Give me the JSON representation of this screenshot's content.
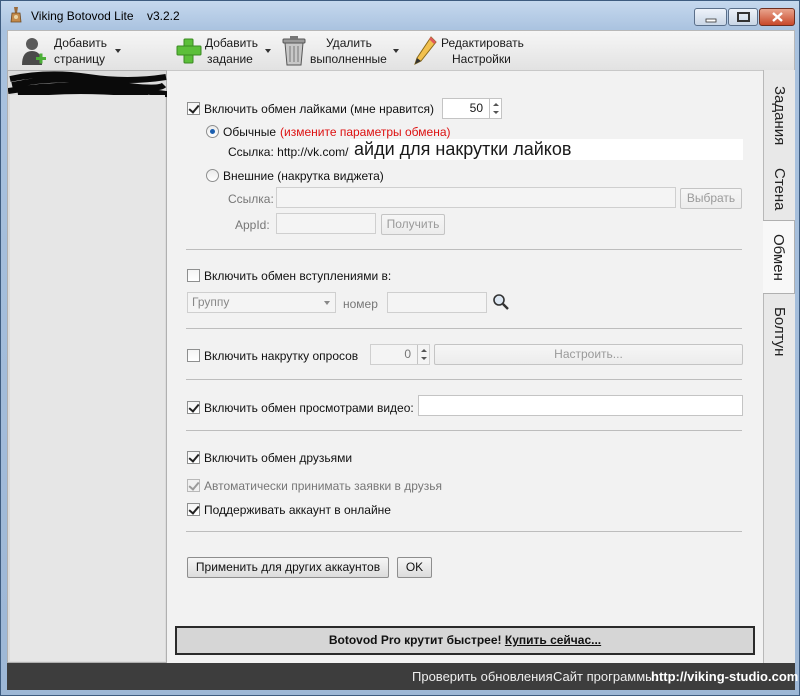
{
  "window": {
    "title": "Viking Botovod Lite",
    "version": "v3.2.2"
  },
  "toolbar": {
    "add_page": [
      "Добавить",
      "страницу"
    ],
    "add_task": [
      "Добавить",
      "задание"
    ],
    "delete_done": [
      "Удалить",
      "выполненные"
    ],
    "edit_settings": [
      "Редактировать",
      "Настройки"
    ]
  },
  "tabs": [
    "Задания",
    "Стена",
    "Обмен",
    "Болтун"
  ],
  "active_tab": "Обмен",
  "likes": {
    "checkbox_label": "Включить обмен лайками (мне нравится)",
    "checked": true,
    "count": "50",
    "normal_label": "Обычные",
    "normal_hint": "(измените параметры обмена)",
    "link_label": "Ссылка: http://vk.com/",
    "link_value": "айди для накрутки лайков",
    "external_label": "Внешние (накрутка виджета)",
    "ext_link_label": "Ссылка:",
    "choose_button": "Выбрать",
    "appid_label": "AppId:",
    "get_button": "Получить"
  },
  "joins": {
    "checkbox_label": "Включить обмен вступлениями в:",
    "checked": false,
    "select_value": "Группу",
    "number_label": "номер"
  },
  "polls": {
    "checkbox_label": "Включить накрутку опросов",
    "checked": false,
    "count": "0",
    "configure_button": "Настроить..."
  },
  "video": {
    "checkbox_label": "Включить обмен просмотрами видео:",
    "checked": true
  },
  "friends": {
    "checkbox_label": "Включить обмен друзьями",
    "checked": true,
    "auto_accept_label": "Автоматически принимать заявки в друзья",
    "online_label": "Поддерживать аккаунт в онлайне"
  },
  "actions": {
    "apply_button": "Применить для других аккаунтов",
    "ok_button": "OK"
  },
  "promo": {
    "text": "Botovod Pro крутит быстрее!",
    "link": "Купить сейчас..."
  },
  "statusbar": {
    "check_updates": "Проверить обновления",
    "site_label": "Сайт программы:",
    "site_url": "http://viking-studio.com"
  }
}
